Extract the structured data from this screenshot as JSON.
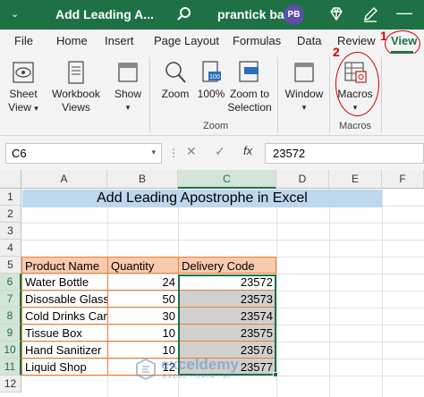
{
  "titlebar": {
    "title": "Add Leading A...",
    "user": "prantick bala",
    "avatar_initials": "PB",
    "accent": "#1e7145"
  },
  "tabs": [
    "File",
    "Home",
    "Insert",
    "Page Layout",
    "Formulas",
    "Data",
    "Review",
    "View"
  ],
  "active_tab": "View",
  "annotations": {
    "step1": "1",
    "step2": "2",
    "color": "#d40000"
  },
  "ribbon": {
    "sheet_view": "Sheet View",
    "workbook_views": "Workbook Views",
    "show": "Show",
    "zoom": "Zoom",
    "zoom100": "100%",
    "zoom_to_selection": "Zoom to Selection",
    "window": "Window",
    "macros": "Macros",
    "groups": {
      "zoom": "Zoom",
      "macros": "Macros"
    }
  },
  "formula_bar": {
    "name_box": "C6",
    "fx_label": "fx",
    "value": "23572"
  },
  "sheet": {
    "columns": [
      "A",
      "B",
      "C",
      "D",
      "E",
      "F"
    ],
    "selected_column": "C",
    "rows": [
      "1",
      "2",
      "3",
      "4",
      "5",
      "6",
      "7",
      "8",
      "9",
      "10",
      "11",
      "12"
    ],
    "title": "Add Leading Apostrophe in Excel",
    "table_headers": [
      "Product Name",
      "Quantity",
      "Delivery Code"
    ],
    "table_rows": [
      [
        "Water Bottle",
        "24",
        "23572"
      ],
      [
        "Disosable Glass",
        "50",
        "23573"
      ],
      [
        "Cold Drinks Can",
        "30",
        "23574"
      ],
      [
        "Tissue Box",
        "10",
        "23575"
      ],
      [
        "Hand Sanitizer",
        "10",
        "23576"
      ],
      [
        "Liquid Shop",
        "12",
        "23577"
      ]
    ]
  },
  "watermark": {
    "name": "exceldemy",
    "tagline": "EXCEL · DATA · BI"
  }
}
